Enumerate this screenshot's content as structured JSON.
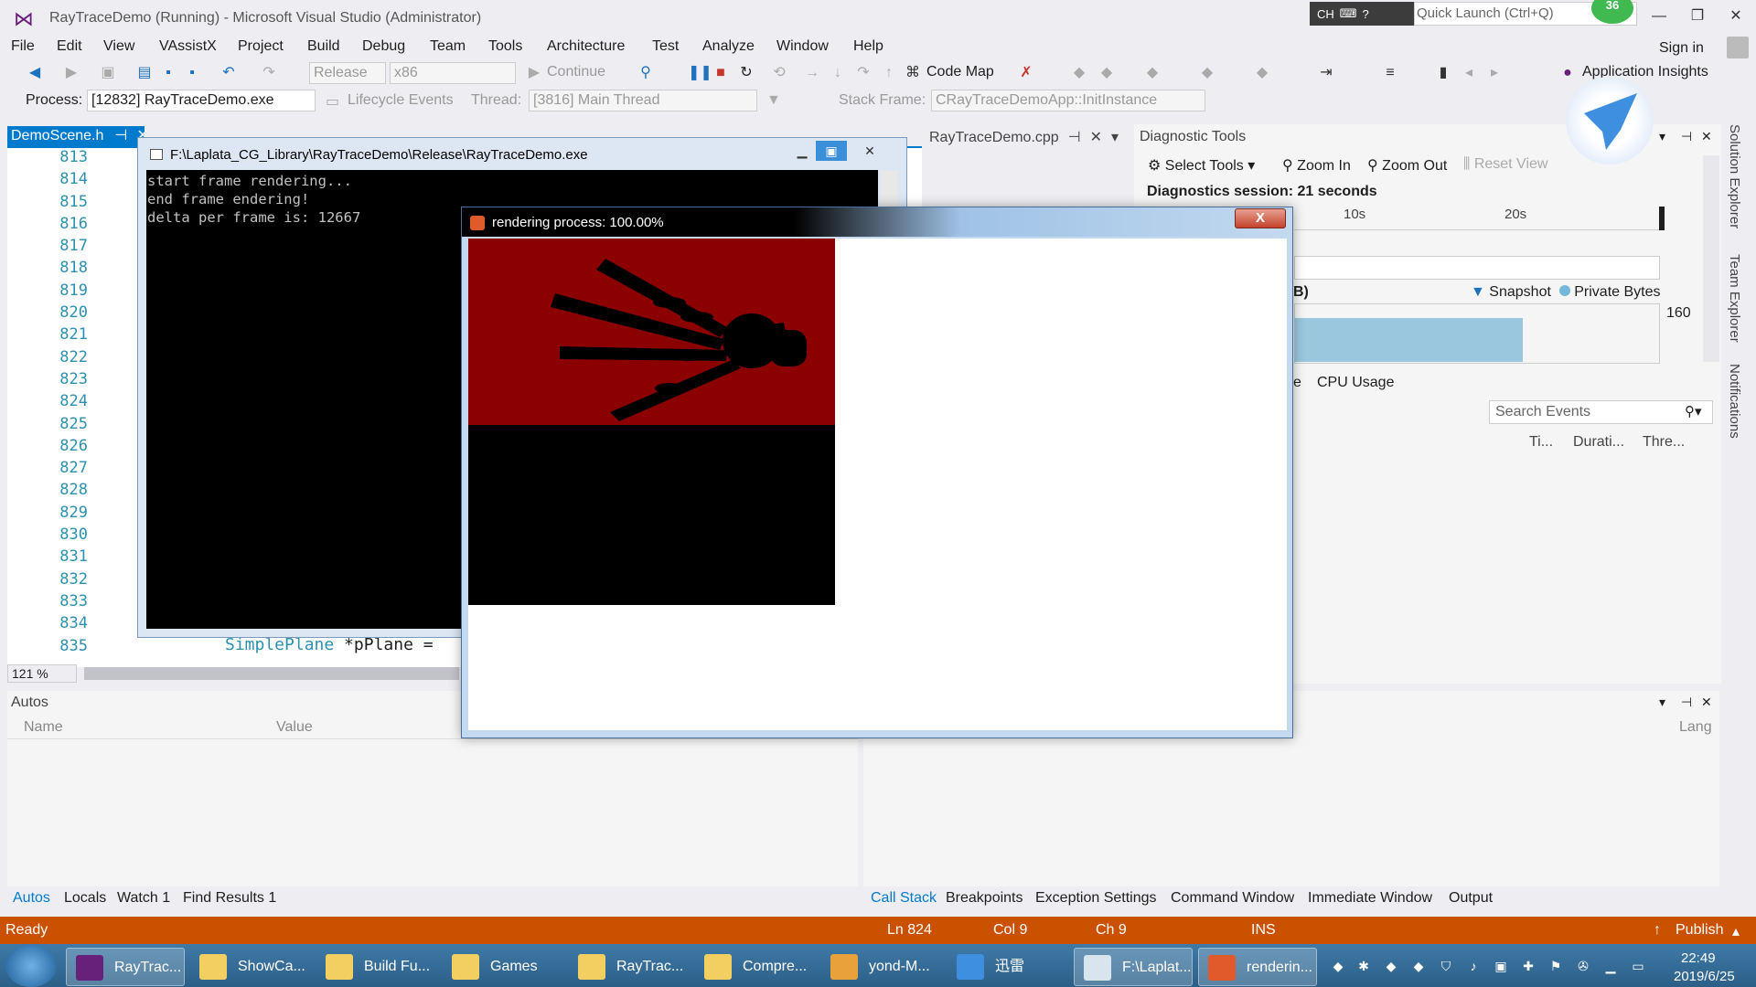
{
  "window": {
    "title": "RayTraceDemo (Running) - Microsoft Visual Studio (Administrator)",
    "ime": "CH",
    "quick_launch_placeholder": "Quick Launch (Ctrl+Q)",
    "notification_count": "36"
  },
  "menu": [
    "File",
    "Edit",
    "View",
    "VAssistX",
    "Project",
    "Build",
    "Debug",
    "Team",
    "Tools",
    "Architecture",
    "Test",
    "Analyze",
    "Window",
    "Help"
  ],
  "account": {
    "sign_in": "Sign in"
  },
  "toolbar": {
    "configuration": "Release",
    "platform": "x86",
    "continue_label": "Continue",
    "code_map_label": "Code Map",
    "app_insights_label": "Application Insights"
  },
  "debug_location": {
    "process_label": "Process:",
    "process_value": "[12832] RayTraceDemo.exe",
    "lifecycle_label": "Lifecycle Events",
    "thread_label": "Thread:",
    "thread_value": "[3816] Main Thread",
    "stack_frame_label": "Stack Frame:",
    "stack_frame_value": "CRayTraceDemoApp::InitInstance"
  },
  "editor": {
    "active_tab": "DemoScene.h",
    "second_tab": "RayTraceDemo.cpp",
    "line_numbers": [
      "813",
      "814",
      "815",
      "816",
      "817",
      "818",
      "819",
      "820",
      "821",
      "822",
      "823",
      "824",
      "825",
      "826",
      "827",
      "828",
      "829",
      "830",
      "831",
      "832",
      "833",
      "834",
      "835"
    ],
    "code_835_type": "SimplePlane",
    "code_835_rest": " *pPlane =",
    "zoom": "121 %"
  },
  "console": {
    "title": "F:\\Laplata_CG_Library\\RayTraceDemo\\Release\\RayTraceDemo.exe",
    "lines": "start frame rendering...\nend frame endering!\ndelta per frame is: 12667"
  },
  "render_window": {
    "title": "rendering process: 100.00%",
    "close_symbol": "X"
  },
  "diagnostic": {
    "title": "Diagnostic Tools",
    "select_tools": "Select Tools",
    "zoom_in": "Zoom In",
    "zoom_out": "Zoom Out",
    "reset_view": "Reset View",
    "session": "Diagnostics session: 21 seconds",
    "tick_10s": "10s",
    "tick_20s": "20s",
    "mem_unit_partial": "B)",
    "legend_snapshot": "Snapshot",
    "legend_private": "Private Bytes",
    "axis_max": "160",
    "tab_partial": "e",
    "cpu_usage_tab": "CPU Usage",
    "search_placeholder": "Search Events",
    "columns": [
      "Ti...",
      "Durati...",
      "Thre..."
    ]
  },
  "side_tabs": [
    "Solution Explorer",
    "Team Explorer",
    "Notifications"
  ],
  "autos": {
    "title": "Autos",
    "col_name": "Name",
    "col_value": "Value",
    "col_lang": "Lang"
  },
  "bottom_tabs_left": [
    "Autos",
    "Locals",
    "Watch 1",
    "Find Results 1"
  ],
  "bottom_tabs_right": [
    "Call Stack",
    "Breakpoints",
    "Exception Settings",
    "Command Window",
    "Immediate Window",
    "Output"
  ],
  "status": {
    "ready": "Ready",
    "ln": "Ln 824",
    "col": "Col 9",
    "ch": "Ch 9",
    "ins": "INS",
    "publish": "Publish"
  },
  "taskbar": {
    "items": [
      "RayTrac...",
      "ShowCa...",
      "Build Fu...",
      "Games",
      "RayTrac...",
      "Compre...",
      "yond-M...",
      "迅雷",
      "F:\\Laplat...",
      "renderin..."
    ],
    "time": "22:49",
    "date": "2019/6/25"
  },
  "colors": {
    "accent": "#007acc",
    "status_bar": "#ca5100",
    "render_red": "#8b0000"
  }
}
